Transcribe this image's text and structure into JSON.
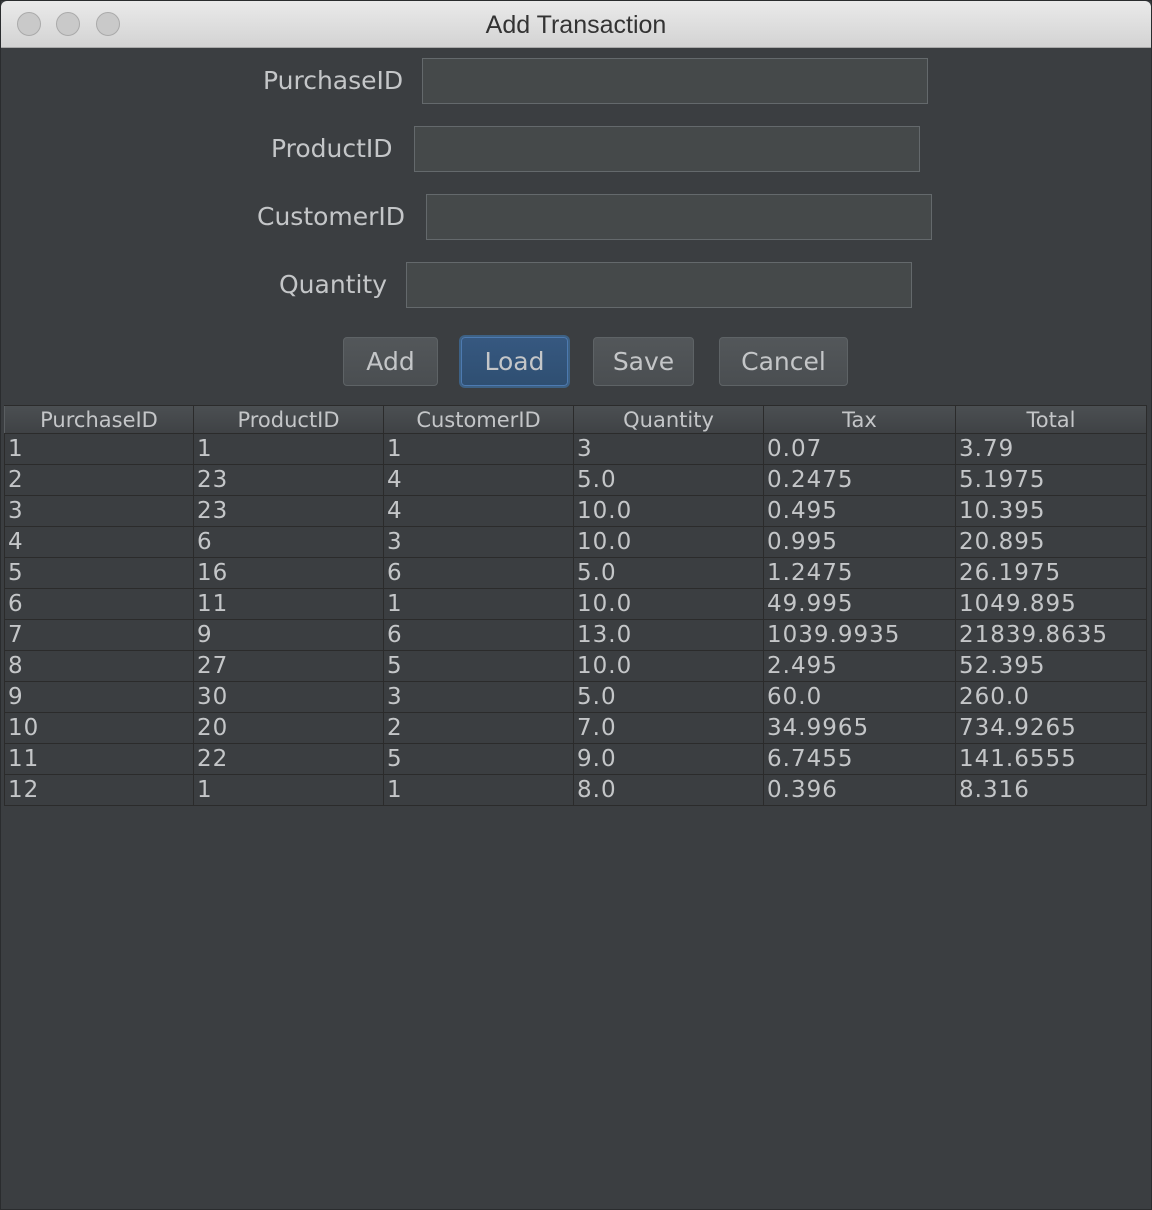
{
  "window": {
    "title": "Add Transaction"
  },
  "form": {
    "fields": [
      {
        "label": "PurchaseID",
        "value": ""
      },
      {
        "label": "ProductID",
        "value": ""
      },
      {
        "label": "CustomerID",
        "value": ""
      },
      {
        "label": "Quantity",
        "value": ""
      }
    ]
  },
  "buttons": {
    "add": "Add",
    "load": "Load",
    "save": "Save",
    "cancel": "Cancel"
  },
  "table": {
    "columns": [
      "PurchaseID",
      "ProductID",
      "CustomerID",
      "Quantity",
      "Tax",
      "Total"
    ],
    "rows": [
      [
        "1",
        "1",
        "1",
        "3",
        "0.07",
        "3.79"
      ],
      [
        "2",
        "23",
        "4",
        "5.0",
        "0.2475",
        "5.1975"
      ],
      [
        "3",
        "23",
        "4",
        "10.0",
        "0.495",
        "10.395"
      ],
      [
        "4",
        "6",
        "3",
        "10.0",
        "0.995",
        "20.895"
      ],
      [
        "5",
        "16",
        "6",
        "5.0",
        "1.2475",
        "26.1975"
      ],
      [
        "6",
        "11",
        "1",
        "10.0",
        "49.995",
        "1049.895"
      ],
      [
        "7",
        "9",
        "6",
        "13.0",
        "1039.9935",
        "21839.8635"
      ],
      [
        "8",
        "27",
        "5",
        "10.0",
        "2.495",
        "52.395"
      ],
      [
        "9",
        "30",
        "3",
        "5.0",
        "60.0",
        "260.0"
      ],
      [
        "10",
        "20",
        "2",
        "7.0",
        "34.9965",
        "734.9265"
      ],
      [
        "11",
        "22",
        "5",
        "9.0",
        "6.7455",
        "141.6555"
      ],
      [
        "12",
        "1",
        "1",
        "8.0",
        "0.396",
        "8.316"
      ]
    ]
  },
  "colors": {
    "background": "#3b3e41",
    "text": "#c4c6c8",
    "default_button": "#365880"
  }
}
